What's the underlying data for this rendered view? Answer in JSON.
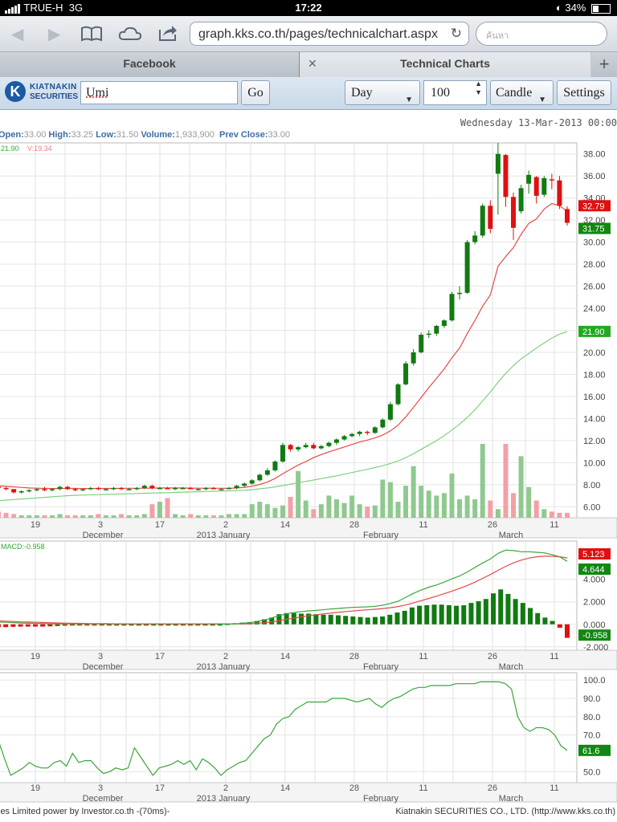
{
  "status": {
    "carrier": "TRUE-H",
    "network": "3G",
    "time": "17:22",
    "battery": "34%"
  },
  "browser": {
    "url": "graph.kks.co.th/pages/technicalchart.aspx",
    "search_placeholder": "ค้นหา",
    "tabs": [
      {
        "label": "Facebook"
      },
      {
        "label": "Technical Charts"
      }
    ],
    "new_tab": "+"
  },
  "app": {
    "logo_line1": "KIATNAKIN",
    "logo_line2": "SECURITIES",
    "symbol": "Umi",
    "go_label": "Go",
    "period": "Day",
    "count": "100",
    "chart_type": "Candle",
    "settings_label": "Settings"
  },
  "quote": {
    "date": "Wednesday 13-Mar-2013 00:00",
    "open_label": "Open:",
    "open": "33.00",
    "high_label": "High:",
    "high": "33.25",
    "low_label": "Low:",
    "low": "31.50",
    "volume_label": "Volume:",
    "volume": "1,933,900",
    "prevclose_label": "Prev Close:",
    "prevclose": "33.00"
  },
  "chart_data": [
    {
      "type": "candlestick",
      "indicators_text": [
        "21.90",
        "V:19.34"
      ],
      "y_ticks": [
        "38.00",
        "36.00",
        "34.00",
        "32.00",
        "30.00",
        "28.00",
        "26.00",
        "24.00",
        "22.00",
        "20.00",
        "18.00",
        "16.00",
        "14.00",
        "12.00",
        "10.00",
        "8.00",
        "6.00"
      ],
      "y_range": [
        5,
        39
      ],
      "price_tags": [
        {
          "value": "32.79",
          "color": "#e01010"
        },
        {
          "value": "31.75",
          "color": "#118811"
        },
        {
          "value": "21.90",
          "color": "#22aa22"
        }
      ],
      "x_ticks": [
        "19",
        "3",
        "17",
        "2",
        "14",
        "28",
        "11",
        "26",
        "11"
      ],
      "month_labels": [
        "December",
        "2013 January",
        "February",
        "March"
      ],
      "up_color": "#117a11",
      "down_color": "#e01010",
      "candles": [
        [
          7.8,
          7.9,
          7.6,
          7.7
        ],
        [
          7.7,
          7.8,
          7.5,
          7.6
        ],
        [
          7.6,
          7.6,
          7.2,
          7.3
        ],
        [
          7.3,
          7.5,
          7.2,
          7.4
        ],
        [
          7.4,
          7.6,
          7.3,
          7.5
        ],
        [
          7.5,
          7.7,
          7.4,
          7.6
        ],
        [
          7.6,
          7.8,
          7.4,
          7.5
        ],
        [
          7.5,
          7.7,
          7.4,
          7.6
        ],
        [
          7.6,
          7.9,
          7.5,
          7.8
        ],
        [
          7.8,
          7.9,
          7.5,
          7.6
        ],
        [
          7.6,
          7.7,
          7.4,
          7.5
        ],
        [
          7.5,
          7.6,
          7.4,
          7.6
        ],
        [
          7.6,
          7.8,
          7.5,
          7.7
        ],
        [
          7.7,
          7.8,
          7.5,
          7.6
        ],
        [
          7.6,
          7.7,
          7.5,
          7.6
        ],
        [
          7.6,
          7.8,
          7.5,
          7.7
        ],
        [
          7.7,
          7.8,
          7.5,
          7.6
        ],
        [
          7.6,
          7.7,
          7.5,
          7.6
        ],
        [
          7.6,
          7.8,
          7.5,
          7.7
        ],
        [
          7.7,
          8.0,
          7.6,
          7.9
        ],
        [
          7.9,
          8.0,
          7.6,
          7.7
        ],
        [
          7.7,
          7.8,
          7.6,
          7.7
        ],
        [
          7.7,
          7.8,
          7.6,
          7.6
        ],
        [
          7.6,
          7.8,
          7.5,
          7.7
        ],
        [
          7.7,
          7.8,
          7.6,
          7.7
        ],
        [
          7.7,
          7.8,
          7.6,
          7.6
        ],
        [
          7.6,
          7.7,
          7.5,
          7.6
        ],
        [
          7.6,
          7.8,
          7.5,
          7.7
        ],
        [
          7.7,
          7.8,
          7.6,
          7.6
        ],
        [
          7.6,
          7.7,
          7.5,
          7.6
        ],
        [
          7.6,
          7.8,
          7.6,
          7.7
        ],
        [
          7.7,
          8.0,
          7.6,
          7.9
        ],
        [
          7.9,
          8.2,
          7.8,
          8.1
        ],
        [
          8.1,
          8.5,
          8.0,
          8.4
        ],
        [
          8.4,
          9.0,
          8.3,
          8.9
        ],
        [
          8.9,
          9.5,
          8.8,
          9.3
        ],
        [
          9.3,
          10.2,
          9.2,
          10.1
        ],
        [
          10.1,
          11.8,
          10.0,
          11.6
        ],
        [
          11.6,
          11.7,
          11.0,
          11.2
        ],
        [
          11.2,
          11.5,
          11.0,
          11.4
        ],
        [
          11.4,
          11.8,
          11.3,
          11.6
        ],
        [
          11.6,
          11.8,
          11.2,
          11.3
        ],
        [
          11.3,
          11.6,
          11.2,
          11.5
        ],
        [
          11.5,
          11.9,
          11.4,
          11.8
        ],
        [
          11.8,
          12.2,
          11.6,
          12.1
        ],
        [
          12.1,
          12.5,
          12.0,
          12.4
        ],
        [
          12.4,
          12.7,
          12.3,
          12.6
        ],
        [
          12.6,
          12.9,
          12.4,
          12.8
        ],
        [
          12.8,
          12.9,
          12.5,
          12.7
        ],
        [
          12.7,
          13.3,
          12.6,
          13.2
        ],
        [
          13.2,
          14.0,
          13.1,
          13.9
        ],
        [
          13.9,
          15.5,
          13.8,
          15.3
        ],
        [
          15.3,
          17.2,
          15.2,
          17.1
        ],
        [
          17.1,
          19.2,
          17.0,
          19.0
        ],
        [
          19.0,
          20.3,
          18.8,
          20.0
        ],
        [
          20.0,
          21.8,
          19.9,
          21.6
        ],
        [
          21.6,
          22.0,
          21.3,
          21.7
        ],
        [
          21.7,
          22.5,
          21.5,
          22.4
        ],
        [
          22.4,
          23.0,
          22.2,
          22.9
        ],
        [
          22.9,
          25.5,
          22.8,
          25.3
        ],
        [
          25.3,
          26.0,
          24.8,
          25.4
        ],
        [
          25.4,
          30.2,
          25.3,
          30.0
        ],
        [
          30.0,
          31.0,
          29.8,
          30.6
        ],
        [
          30.6,
          33.5,
          30.4,
          33.3
        ],
        [
          33.3,
          33.8,
          30.8,
          31.2
        ],
        [
          36.2,
          39.0,
          32.5,
          38.0
        ],
        [
          37.9,
          38.0,
          33.2,
          34.1
        ],
        [
          34.1,
          34.5,
          30.2,
          31.3
        ],
        [
          32.8,
          35.2,
          32.6,
          34.9
        ],
        [
          35.3,
          36.5,
          34.4,
          36.1
        ],
        [
          35.9,
          36.0,
          33.5,
          34.2
        ],
        [
          34.3,
          36.0,
          34.1,
          35.8
        ],
        [
          35.7,
          36.2,
          34.8,
          35.6
        ],
        [
          35.6,
          36.0,
          33.0,
          33.3
        ],
        [
          33.0,
          33.25,
          31.5,
          31.75
        ]
      ],
      "ma_short": [
        7.9,
        7.85,
        7.8,
        7.75,
        7.7,
        7.68,
        7.66,
        7.65,
        7.66,
        7.67,
        7.66,
        7.65,
        7.65,
        7.66,
        7.66,
        7.66,
        7.67,
        7.67,
        7.67,
        7.68,
        7.69,
        7.7,
        7.7,
        7.7,
        7.7,
        7.69,
        7.68,
        7.68,
        7.68,
        7.67,
        7.67,
        7.7,
        7.76,
        7.86,
        8.02,
        8.25,
        8.56,
        9.0,
        9.4,
        9.78,
        10.1,
        10.45,
        10.73,
        10.98,
        11.2,
        11.42,
        11.65,
        11.87,
        12.04,
        12.25,
        12.5,
        12.88,
        13.4,
        14.15,
        15.0,
        15.9,
        16.8,
        17.65,
        18.5,
        19.5,
        20.4,
        21.7,
        22.9,
        24.2,
        25.2,
        27.8,
        28.7,
        29.5,
        30.7,
        31.7,
        32.1,
        33.0,
        33.5,
        33.3,
        32.8
      ],
      "ma_long": [
        6.55,
        6.6,
        6.65,
        6.7,
        6.75,
        6.8,
        6.85,
        6.9,
        6.95,
        7.0,
        7.03,
        7.06,
        7.08,
        7.1,
        7.12,
        7.14,
        7.16,
        7.18,
        7.2,
        7.22,
        7.24,
        7.26,
        7.28,
        7.3,
        7.32,
        7.34,
        7.36,
        7.38,
        7.4,
        7.42,
        7.44,
        7.46,
        7.5,
        7.55,
        7.62,
        7.7,
        7.8,
        7.92,
        8.05,
        8.18,
        8.3,
        8.42,
        8.55,
        8.68,
        8.8,
        8.95,
        9.1,
        9.25,
        9.4,
        9.55,
        9.72,
        9.92,
        10.15,
        10.45,
        10.8,
        11.2,
        11.6,
        12.0,
        12.45,
        12.95,
        13.5,
        14.1,
        14.8,
        15.6,
        16.4,
        17.3,
        18.1,
        18.8,
        19.4,
        19.9,
        20.4,
        20.85,
        21.3,
        21.65,
        21.9
      ],
      "volumes": [
        5,
        4,
        3,
        2,
        2,
        2,
        2,
        2,
        3,
        2,
        2,
        2,
        2,
        3,
        2,
        2,
        3,
        2,
        2,
        3,
        11,
        13,
        16,
        3,
        2,
        3,
        2,
        2,
        2,
        2,
        3,
        3,
        3,
        11,
        13,
        11,
        8,
        10,
        17,
        38,
        14,
        7,
        11,
        18,
        15,
        12,
        18,
        11,
        9,
        10,
        31,
        29,
        13,
        26,
        42,
        26,
        22,
        18,
        20,
        36,
        15,
        18,
        15,
        60,
        14,
        7,
        60,
        20,
        50,
        25,
        14,
        7,
        5,
        4,
        4
      ],
      "volume_max": 60
    },
    {
      "type": "macd",
      "label": "MACD:-0.958",
      "y_ticks": [
        "4.000",
        "2.000",
        "0.000",
        "-2.000"
      ],
      "y_range": [
        -2.3,
        7.4
      ],
      "tags": [
        {
          "value": "5.123",
          "color": "#e01010"
        },
        {
          "value": "4.644",
          "color": "#118811"
        },
        {
          "value": "-0.958",
          "color": "#118811"
        }
      ],
      "x_ticks": [
        "19",
        "3",
        "17",
        "2",
        "14",
        "28",
        "11",
        "26",
        "11"
      ],
      "month_labels": [
        "December",
        "2013 January",
        "February",
        "March"
      ],
      "macd": [
        0.2,
        0.18,
        0.15,
        0.12,
        0.1,
        0.08,
        0.06,
        0.05,
        0.05,
        0.05,
        0.04,
        0.04,
        0.04,
        0.04,
        0.03,
        0.03,
        0.03,
        0.03,
        0.03,
        0.03,
        0.03,
        0.03,
        0.03,
        0.03,
        0.03,
        0.03,
        0.03,
        0.03,
        0.03,
        0.03,
        0.03,
        0.05,
        0.1,
        0.18,
        0.3,
        0.45,
        0.65,
        0.85,
        1.0,
        1.1,
        1.17,
        1.22,
        1.28,
        1.35,
        1.4,
        1.45,
        1.5,
        1.53,
        1.55,
        1.6,
        1.7,
        1.85,
        2.05,
        2.4,
        2.75,
        3.05,
        3.3,
        3.5,
        3.75,
        4.05,
        4.3,
        4.65,
        5.05,
        5.45,
        5.8,
        6.3,
        6.6,
        6.55,
        6.45,
        6.45,
        6.4,
        6.35,
        6.2,
        6.0,
        5.6
      ],
      "signal": [
        0.3,
        0.28,
        0.25,
        0.22,
        0.2,
        0.18,
        0.16,
        0.14,
        0.12,
        0.1,
        0.09,
        0.08,
        0.07,
        0.06,
        0.06,
        0.05,
        0.05,
        0.04,
        0.04,
        0.04,
        0.04,
        0.04,
        0.04,
        0.04,
        0.04,
        0.04,
        0.04,
        0.04,
        0.04,
        0.04,
        0.04,
        0.04,
        0.05,
        0.07,
        0.11,
        0.17,
        0.26,
        0.38,
        0.5,
        0.62,
        0.73,
        0.82,
        0.9,
        0.98,
        1.05,
        1.12,
        1.18,
        1.24,
        1.29,
        1.34,
        1.4,
        1.48,
        1.58,
        1.72,
        1.9,
        2.1,
        2.3,
        2.5,
        2.72,
        2.95,
        3.2,
        3.45,
        3.75,
        4.08,
        4.42,
        4.8,
        5.15,
        5.45,
        5.7,
        5.88,
        6.0,
        6.05,
        6.05,
        6.0,
        5.9
      ],
      "histogram": [
        -0.25,
        -0.25,
        -0.22,
        -0.2,
        -0.2,
        -0.2,
        -0.2,
        -0.18,
        -0.15,
        -0.12,
        -0.1,
        -0.08,
        -0.06,
        -0.05,
        -0.05,
        -0.05,
        -0.04,
        -0.04,
        -0.04,
        -0.03,
        -0.03,
        -0.03,
        -0.03,
        -0.03,
        -0.02,
        -0.02,
        -0.02,
        -0.02,
        -0.02,
        -0.01,
        0.0,
        0.05,
        0.1,
        0.15,
        0.2,
        0.3,
        0.45,
        0.6,
        0.9,
        1.0,
        1.0,
        0.95,
        0.95,
        0.9,
        0.85,
        0.85,
        0.8,
        0.75,
        0.7,
        0.65,
        0.6,
        0.65,
        0.7,
        0.85,
        1.05,
        1.2,
        1.5,
        1.65,
        1.7,
        1.75,
        1.75,
        1.7,
        1.65,
        1.7,
        1.9,
        2.05,
        2.25,
        2.75,
        3.1,
        2.7,
        2.25,
        1.9,
        1.45,
        1.0,
        0.6,
        0.3,
        -0.3,
        -1.2
      ],
      "hist_color": "#117a11",
      "hist_neg_color": "#e01010"
    },
    {
      "type": "line",
      "y_ticks": [
        "100.0",
        "90.0",
        "80.0",
        "70.0",
        "61.6",
        "50.0"
      ],
      "y_range": [
        44,
        104
      ],
      "tag": {
        "value": "61.6",
        "color": "#118811"
      },
      "x_ticks": [
        "19",
        "3",
        "17",
        "2",
        "14",
        "28",
        "11",
        "26",
        "11"
      ],
      "month_labels": [
        "December",
        "2013 January",
        "February",
        "March"
      ],
      "values": [
        67,
        57,
        48,
        50,
        52,
        55,
        53,
        52,
        52,
        55,
        56,
        53,
        60,
        55,
        56,
        56,
        52,
        49,
        50,
        52,
        51,
        52,
        63,
        58,
        53,
        48,
        52,
        53,
        54,
        56,
        54,
        56,
        51,
        57,
        55,
        52,
        48,
        51,
        53,
        55,
        56,
        60,
        64,
        68,
        70,
        76,
        79,
        80,
        84,
        86,
        88,
        88,
        88,
        88,
        90,
        90,
        90,
        89,
        88,
        89,
        90,
        87,
        85,
        88,
        90,
        91,
        93,
        95,
        96,
        96,
        97,
        97,
        97,
        97,
        98,
        98,
        98,
        98,
        99,
        99,
        99,
        99,
        98,
        95,
        80,
        74,
        72,
        74,
        74,
        73,
        70,
        64,
        61.6
      ]
    }
  ],
  "footer": {
    "left": "ies Limited power by Investor.co.th  -(70ms)-",
    "right": "Kiatnakin SECURITIES CO., LTD. (http://www.kks.co.th)"
  }
}
